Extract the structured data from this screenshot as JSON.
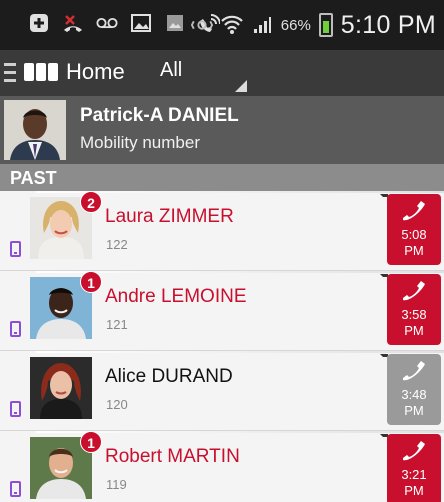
{
  "status_bar": {
    "battery_text": "66%",
    "time": "5:10 PM"
  },
  "app_bar": {
    "title": "Home",
    "filter": "All"
  },
  "profile": {
    "name": "Patrick-A DANIEL",
    "subtitle": "Mobility number"
  },
  "section": {
    "label": "PAST"
  },
  "calls": [
    {
      "name": "Laura ZIMMER",
      "ext": "122",
      "badge": "2",
      "time_line1": "5:08",
      "time_line2": "PM",
      "missed": true
    },
    {
      "name": "Andre LEMOINE",
      "ext": "121",
      "badge": "1",
      "time_line1": "3:58",
      "time_line2": "PM",
      "missed": true
    },
    {
      "name": "Alice DURAND",
      "ext": "120",
      "badge": "",
      "time_line1": "3:48",
      "time_line2": "PM",
      "missed": false
    },
    {
      "name": "Robert MARTIN",
      "ext": "119",
      "badge": "1",
      "time_line1": "3:21",
      "time_line2": "PM",
      "missed": true
    }
  ],
  "colors": {
    "accent_red": "#c8102e",
    "device_purple": "#8a4fd6",
    "app_bar": "#3a3a3a"
  }
}
